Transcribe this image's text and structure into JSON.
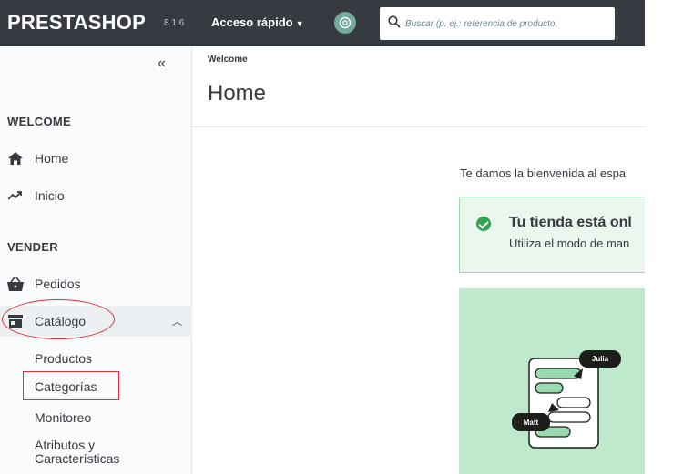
{
  "topbar": {
    "logo": "PRESTASHOP",
    "version": "8.1.6",
    "quick_access": "Acceso rápido",
    "search_placeholder": "Buscar (p. ej.: referencia de producto,"
  },
  "sidebar": {
    "sections": [
      {
        "label": "WELCOME"
      },
      {
        "label": "VENDER"
      }
    ],
    "items": [
      {
        "label": "Home",
        "icon": "home-icon"
      },
      {
        "label": "Inicio",
        "icon": "trending-up-icon"
      },
      {
        "label": "Pedidos",
        "icon": "basket-icon"
      },
      {
        "label": "Catálogo",
        "icon": "store-icon"
      }
    ],
    "catalog_subitems": [
      {
        "label": "Productos"
      },
      {
        "label": "Categorías"
      },
      {
        "label": "Monitoreo"
      },
      {
        "label": "Atributos y Características"
      }
    ]
  },
  "header": {
    "breadcrumb": "Welcome",
    "title": "Home"
  },
  "main": {
    "welcome_text": "Te damos la bienvenida al espa",
    "alert_title": "Tu tienda está onl",
    "alert_subtitle": "Utiliza el modo de man",
    "illustration": {
      "bubble_1": "Julia",
      "bubble_2": "Matt"
    }
  },
  "colors": {
    "topbar": "#363a41",
    "alert_bg": "#eaf7ee",
    "success": "#2ea44f",
    "illustration_bg": "#bfe9cc",
    "annotation": "#e0303a"
  }
}
